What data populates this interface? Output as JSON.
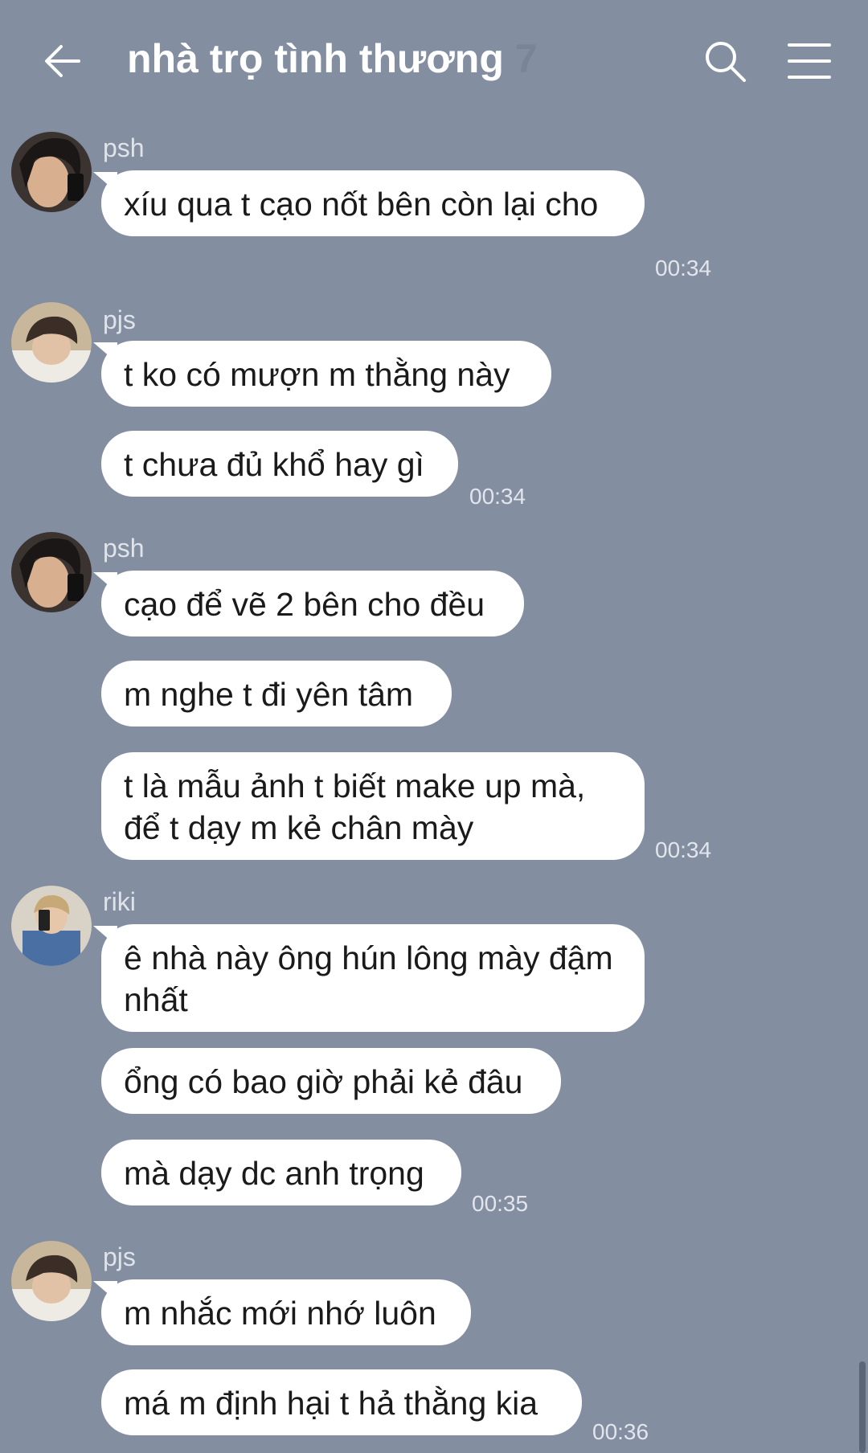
{
  "header": {
    "title": "nhà trọ tình thương",
    "member_count": "7",
    "back_icon": "arrow-left-icon",
    "search_icon": "search-icon",
    "menu_icon": "hamburger-menu-icon"
  },
  "messages": [
    {
      "sender": "psh",
      "lines": [
        "xíu qua t cạo nốt bên còn lại cho"
      ],
      "time": "00:34"
    },
    {
      "sender": "pjs",
      "lines": [
        "t ko có mượn m thằng này",
        "t chưa đủ khổ hay gì"
      ],
      "time": "00:34"
    },
    {
      "sender": "psh",
      "lines": [
        "cạo để vẽ 2 bên cho đều",
        "m nghe t đi yên tâm",
        "t là mẫu ảnh t biết make up mà, để t dạy m kẻ chân mày"
      ],
      "time": "00:34"
    },
    {
      "sender": "riki",
      "lines": [
        "ê nhà này ông hún lông mày đậm nhất",
        "ổng có bao giờ phải kẻ đâu",
        "mà dạy dc anh trọng"
      ],
      "time": "00:35"
    },
    {
      "sender": "pjs",
      "lines": [
        "m nhắc mới nhớ luôn",
        "má m định hại t hả thằng kia"
      ],
      "time": "00:36"
    }
  ],
  "colors": {
    "background": "#838ea1",
    "bubble": "#ffffff",
    "text": "#1a1a1a"
  }
}
